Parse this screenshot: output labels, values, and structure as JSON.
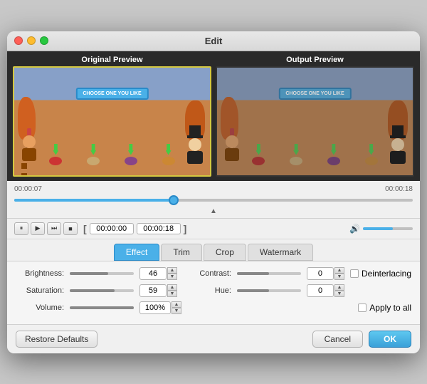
{
  "window": {
    "title": "Edit"
  },
  "preview": {
    "original_label": "Original Preview",
    "output_label": "Output Preview"
  },
  "timeline": {
    "start_time": "00:00:07",
    "end_time": "00:00:18",
    "trim_start": "00:00:00",
    "trim_end": "00:00:18"
  },
  "transport": {
    "pause_label": "⏸",
    "play_label": "▶",
    "next_label": "⏭",
    "stop_label": "⏹"
  },
  "tabs": [
    {
      "id": "effect",
      "label": "Effect",
      "active": true
    },
    {
      "id": "trim",
      "label": "Trim",
      "active": false
    },
    {
      "id": "crop",
      "label": "Crop",
      "active": false
    },
    {
      "id": "watermark",
      "label": "Watermark",
      "active": false
    }
  ],
  "controls": {
    "brightness_label": "Brightness:",
    "brightness_value": "46",
    "contrast_label": "Contrast:",
    "contrast_value": "0",
    "saturation_label": "Saturation:",
    "saturation_value": "59",
    "hue_label": "Hue:",
    "hue_value": "0",
    "volume_label": "Volume:",
    "volume_value": "100%",
    "deinterlacing_label": "Deinterlacing",
    "apply_all_label": "Apply to all"
  },
  "buttons": {
    "restore_defaults": "Restore Defaults",
    "cancel": "Cancel",
    "ok": "OK"
  },
  "scene": {
    "banner_text": "CHOOSE ONE YOU LIKE"
  }
}
